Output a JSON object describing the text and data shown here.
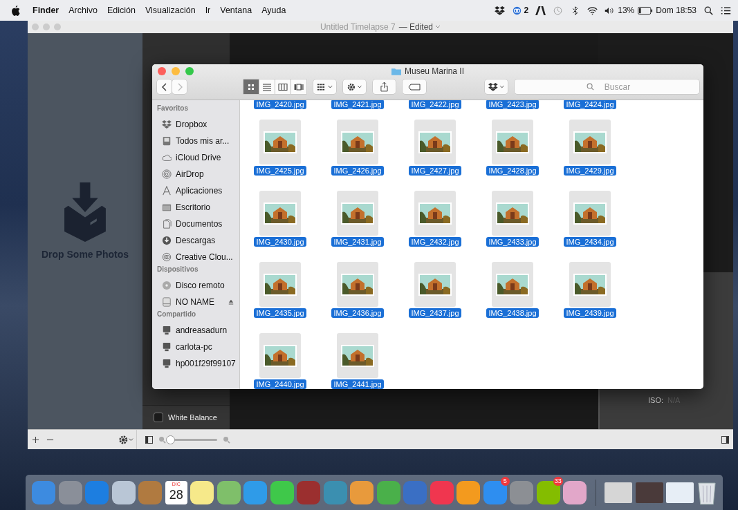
{
  "menu_bar": {
    "app": "Finder",
    "menus": [
      "Archivo",
      "Edición",
      "Visualización",
      "Ir",
      "Ventana",
      "Ayuda"
    ],
    "cc_count": "2",
    "battery": "13%",
    "clock": "Dom 18:53"
  },
  "app_window": {
    "title": "Untitled Timelapse 7",
    "status": "— Edited",
    "drop_label": "Drop Some Photos",
    "white_balance": {
      "label": "White Balance",
      "checked": false
    },
    "iso_label": "ISO:",
    "iso_value": "N/A",
    "zoom_slider": {
      "level": 0
    }
  },
  "finder": {
    "title": "Museu Marina II",
    "view_buttons": [
      {
        "selected": true
      },
      {
        "selected": false
      },
      {
        "selected": false
      },
      {
        "selected": false
      }
    ],
    "search": {
      "placeholder": "Buscar"
    },
    "sidebar": [
      {
        "heading": "Favoritos",
        "items": [
          {
            "label": "Dropbox"
          },
          {
            "label": "Todos mis ar..."
          },
          {
            "label": "iCloud Drive"
          },
          {
            "label": "AirDrop"
          },
          {
            "label": "Aplicaciones"
          },
          {
            "label": "Escritorio"
          },
          {
            "label": "Documentos"
          },
          {
            "label": "Descargas"
          },
          {
            "label": "Creative Clou..."
          }
        ]
      },
      {
        "heading": "Dispositivos",
        "items": [
          {
            "label": "Disco remoto"
          },
          {
            "label": "NO NAME",
            "ejectable": true
          }
        ]
      },
      {
        "heading": "Compartido",
        "items": [
          {
            "label": "andreasadurn"
          },
          {
            "label": "carlota-pc"
          },
          {
            "label": "hp001f29f99107"
          }
        ]
      }
    ],
    "files": [
      {
        "name": "IMG_2420.jpg",
        "kind": "cut",
        "selected": true
      },
      {
        "name": "IMG_2421.jpg",
        "kind": "cut",
        "selected": true
      },
      {
        "name": "IMG_2422.jpg",
        "kind": "cut",
        "selected": true
      },
      {
        "name": "IMG_2423.jpg",
        "kind": "cut",
        "selected": true
      },
      {
        "name": "IMG_2424.jpg",
        "kind": "cut",
        "selected": true
      },
      {
        "name": "IMG_2425.jpg",
        "kind": "photo",
        "selected": true
      },
      {
        "name": "IMG_2426.jpg",
        "kind": "photo",
        "selected": true
      },
      {
        "name": "IMG_2427.jpg",
        "kind": "photo",
        "selected": true
      },
      {
        "name": "IMG_2428.jpg",
        "kind": "photo",
        "selected": true
      },
      {
        "name": "IMG_2429.jpg",
        "kind": "photo",
        "selected": true
      },
      {
        "name": "IMG_2430.jpg",
        "kind": "photo",
        "selected": true
      },
      {
        "name": "IMG_2431.jpg",
        "kind": "photo",
        "selected": true
      },
      {
        "name": "IMG_2432.jpg",
        "kind": "photo",
        "selected": true
      },
      {
        "name": "IMG_2433.jpg",
        "kind": "photo",
        "selected": true
      },
      {
        "name": "IMG_2434.jpg",
        "kind": "photo",
        "selected": true
      },
      {
        "name": "IMG_2435.jpg",
        "kind": "photo",
        "selected": true
      },
      {
        "name": "IMG_2436.jpg",
        "kind": "photo",
        "selected": true
      },
      {
        "name": "IMG_2437.jpg",
        "kind": "photo",
        "selected": true
      },
      {
        "name": "IMG_2438.jpg",
        "kind": "photo",
        "selected": true
      },
      {
        "name": "IMG_2439.jpg",
        "kind": "photo",
        "selected": true
      },
      {
        "name": "IMG_2440.jpg",
        "kind": "photo",
        "selected": true
      },
      {
        "name": "IMG_2441.jpg",
        "kind": "photo",
        "selected": true
      }
    ]
  },
  "dock": [
    {
      "kind": "app",
      "color": "#3d8be0"
    },
    {
      "kind": "app",
      "color": "#8a8f99"
    },
    {
      "kind": "app",
      "color": "#1d7ee0"
    },
    {
      "kind": "app",
      "color": "#b9c6d6"
    },
    {
      "kind": "app",
      "color": "#b07a40"
    },
    {
      "kind": "calendar",
      "month": "DIC",
      "day": "28"
    },
    {
      "kind": "app",
      "color": "#f6e98a"
    },
    {
      "kind": "app",
      "color": "#7fbf6a"
    },
    {
      "kind": "app",
      "color": "#2f9be8"
    },
    {
      "kind": "app",
      "color": "#3fc84a"
    },
    {
      "kind": "app",
      "color": "#9b2f2f"
    },
    {
      "kind": "app",
      "color": "#3b8fb0"
    },
    {
      "kind": "app",
      "color": "#e89a3c"
    },
    {
      "kind": "app",
      "color": "#4ab04a"
    },
    {
      "kind": "app",
      "color": "#3a6fc4"
    },
    {
      "kind": "app",
      "color": "#f0364f"
    },
    {
      "kind": "app",
      "color": "#f39a1e"
    },
    {
      "kind": "app",
      "color": "#2e8ef0",
      "badge": "5"
    },
    {
      "kind": "app",
      "color": "#8c8f94"
    },
    {
      "kind": "app",
      "color": "#84bd00",
      "badge": "33"
    },
    {
      "kind": "app",
      "color": "#e2a7c9"
    },
    {
      "kind": "separator"
    },
    {
      "kind": "window",
      "color": "#d6d6d6"
    },
    {
      "kind": "window",
      "color": "#4a3a3a"
    },
    {
      "kind": "window",
      "color": "#e7eef6"
    },
    {
      "kind": "trash"
    }
  ]
}
